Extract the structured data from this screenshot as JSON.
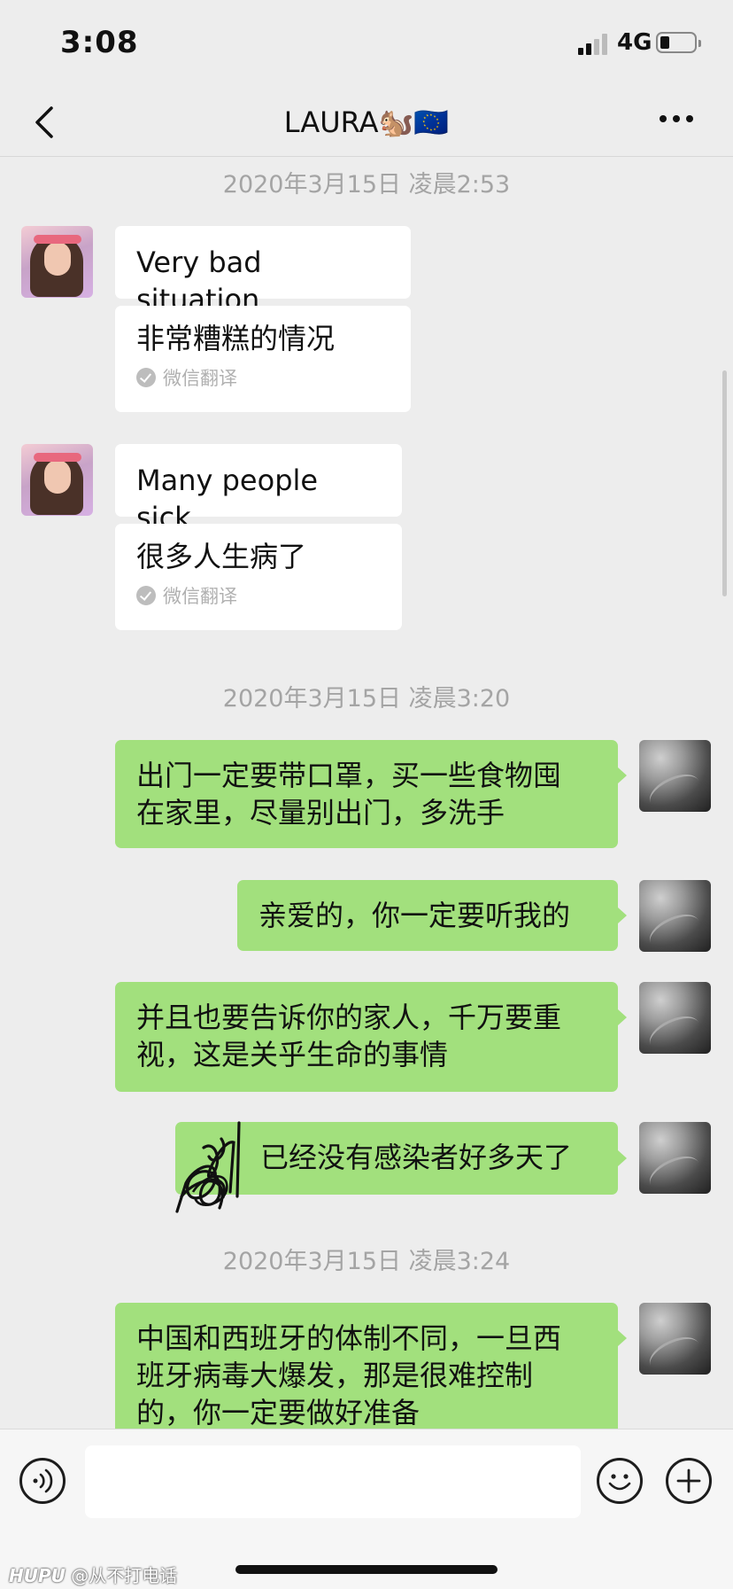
{
  "status_bar": {
    "time": "3:08",
    "network": "4G"
  },
  "nav": {
    "title": "LAURA🐿️🇪🇺"
  },
  "messages": [
    {
      "timestamp": "2020年3月15日 凌晨2:53"
    },
    {
      "sender": "contact",
      "text": "Very bad situation",
      "translation": "非常糟糕的情况",
      "translation_source": "微信翻译"
    },
    {
      "sender": "contact",
      "text": "Many people sick",
      "translation": "很多人生病了",
      "translation_source": "微信翻译"
    },
    {
      "timestamp": "2020年3月15日 凌晨3:20"
    },
    {
      "sender": "me",
      "lines": [
        "出门一定要带口罩，买一些食物囤",
        "在家里，尽量别出门，多洗手"
      ]
    },
    {
      "sender": "me",
      "lines": [
        "亲爱的，你一定要听我的"
      ]
    },
    {
      "sender": "me",
      "lines": [
        "并且也要告诉你的家人，千万要重",
        "视，这是关乎生命的事情"
      ]
    },
    {
      "sender": "me",
      "lines": [
        "已经没有感染者好多天了"
      ]
    },
    {
      "timestamp": "2020年3月15日 凌晨3:24"
    },
    {
      "sender": "me",
      "lines": [
        "中国和西班牙的体制不同，一旦西",
        "班牙病毒大爆发，那是很难控制",
        "的，你一定要做好准备"
      ]
    }
  ],
  "input": {
    "value": "",
    "placeholder": ""
  },
  "icons": {
    "back": "chevron-left-icon",
    "more": "more-dots-icon",
    "voice": "voice-icon",
    "emoji": "emoji-icon",
    "plus": "plus-icon"
  },
  "watermark": {
    "brand": "HUPU",
    "handle": "@从不打电话"
  },
  "colors": {
    "outgoing_bubble": "#a2e07d",
    "incoming_bubble": "#ffffff",
    "background": "#ededed"
  }
}
